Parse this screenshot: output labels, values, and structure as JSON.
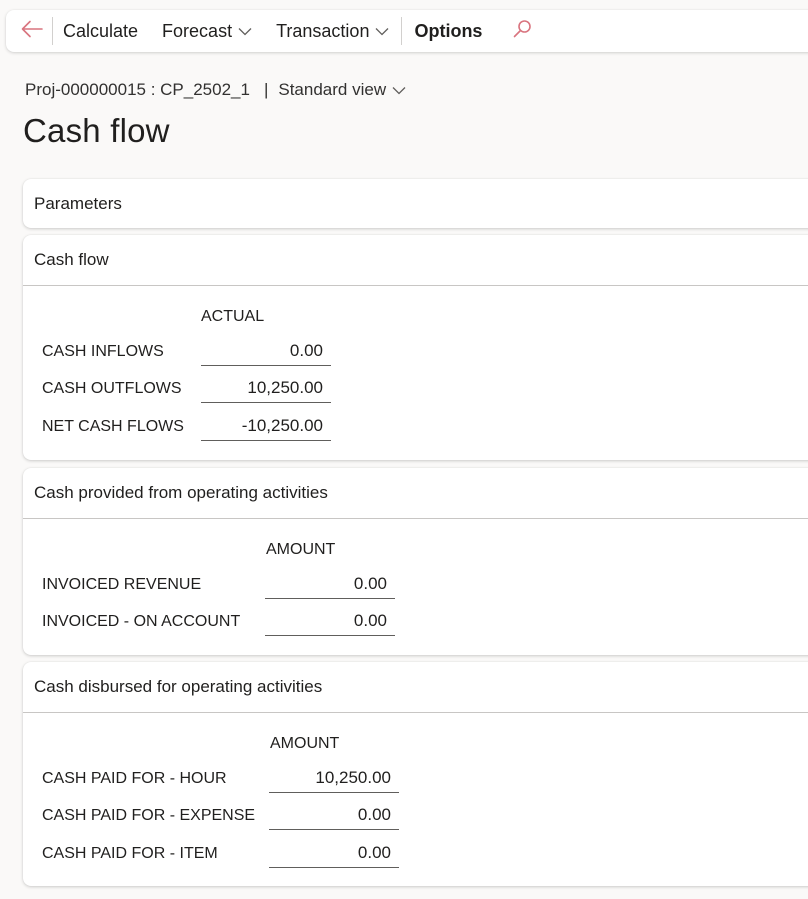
{
  "toolbar": {
    "back_icon": "arrow-left-icon",
    "items": [
      {
        "label": "Calculate",
        "has_dropdown": false
      },
      {
        "label": "Forecast",
        "has_dropdown": true
      },
      {
        "label": "Transaction",
        "has_dropdown": true
      },
      {
        "label": "Options",
        "has_dropdown": false
      }
    ],
    "search_icon": "search-icon"
  },
  "breadcrumb": {
    "record": "Proj-000000015 : CP_2502_1",
    "separator": "|",
    "view": "Standard view"
  },
  "page_title": "Cash flow",
  "sections": {
    "parameters": {
      "title": "Parameters"
    },
    "cash_flow": {
      "title": "Cash flow",
      "column": "ACTUAL",
      "rows": [
        {
          "label": "CASH INFLOWS",
          "value": "0.00"
        },
        {
          "label": "CASH OUTFLOWS",
          "value": "10,250.00"
        },
        {
          "label": "NET CASH FLOWS",
          "value": "-10,250.00"
        }
      ]
    },
    "provided": {
      "title": "Cash provided from operating activities",
      "column": "AMOUNT",
      "rows": [
        {
          "label": "INVOICED REVENUE",
          "value": "0.00"
        },
        {
          "label": "INVOICED - ON ACCOUNT",
          "value": "0.00"
        }
      ]
    },
    "disbursed": {
      "title": "Cash disbursed for operating activities",
      "column": "AMOUNT",
      "rows": [
        {
          "label": "CASH PAID FOR - HOUR",
          "value": "10,250.00"
        },
        {
          "label": "CASH PAID FOR - EXPENSE",
          "value": "0.00"
        },
        {
          "label": "CASH PAID FOR - ITEM",
          "value": "0.00"
        }
      ]
    }
  },
  "colors": {
    "background": "#faf9f8",
    "card": "#ffffff",
    "accent_icon": "#c4314b",
    "text": "#201f1e"
  }
}
